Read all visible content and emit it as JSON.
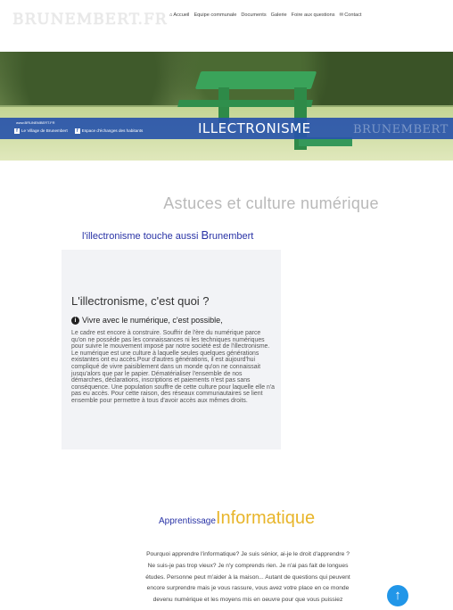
{
  "header": {
    "logo": "BRUNEMBERT.FR",
    "nav": [
      {
        "icon": "home-icon",
        "glyph": "⌂",
        "label": "Accueil"
      },
      {
        "label": "Equipe communale"
      },
      {
        "label": "Documents"
      },
      {
        "label": "Galerie"
      },
      {
        "label": "Foire aux questions"
      },
      {
        "icon": "envelope-icon",
        "glyph": "✉",
        "label": "Contact"
      }
    ]
  },
  "hero": {
    "banner_site": "www.BRUNEMBERT.FR",
    "links": [
      "Le Village de Brunembert",
      "Espace d'échanges des habitants"
    ],
    "title": "ILLECTRONISME",
    "brand": "BRUNEMBERT"
  },
  "main": {
    "page_title": "Astuces et culture numérique",
    "subtitle_pre": "l'illectronisme touche aussi ",
    "subtitle_big": "B",
    "subtitle_post": "runembert",
    "card": {
      "title": "L'illectronisme, c'est quoi ?",
      "lead": "Vivre avec le numérique, c'est possible,",
      "body": "Le cadre est encore à construire. Souffrir de l'ère du numérique parce qu'on ne possède pas les connaissances ni les techniques numériques pour suivre le mouvement imposé par notre société est de l'illectronisme. Le numérique est une culture à laquelle seules quelques générations existantes ont eu accès.Pour d'autres générations, il est aujourd'hui compliqué de vivre paisiblement dans un monde qu'on ne connaissait jusqu'alors que par le papier. Dématérialiser l'ensemble de nos démarches, déclarations, inscriptions et paiements n'est pas sans conséquence. Une population souffre de cette culture pour laquelle elle n'a pas eu accès. Pour cette raison, des réseaux communautaires se lient ensemble pour permettre à tous d'avoir accès aux mêmes droits."
    },
    "section": {
      "title_small": "Apprentissage",
      "title_big": "Informatique",
      "body": "Pourquoi apprendre l'informatique? Je suis sénior, ai-je le droit d'apprendre ? Ne suis-je pas trop vieux? Je n'y comprends rien. Je n'ai pas fait de longues études. Personne peut m'aider à la maison... Autant de questions qui peuvent encore surprendre mais je vous rassure, vous avez votre place en ce monde devenu numérique et les moyens mis en oeuvre pour que vous puissiez"
    },
    "scroll_top_glyph": "↑"
  }
}
